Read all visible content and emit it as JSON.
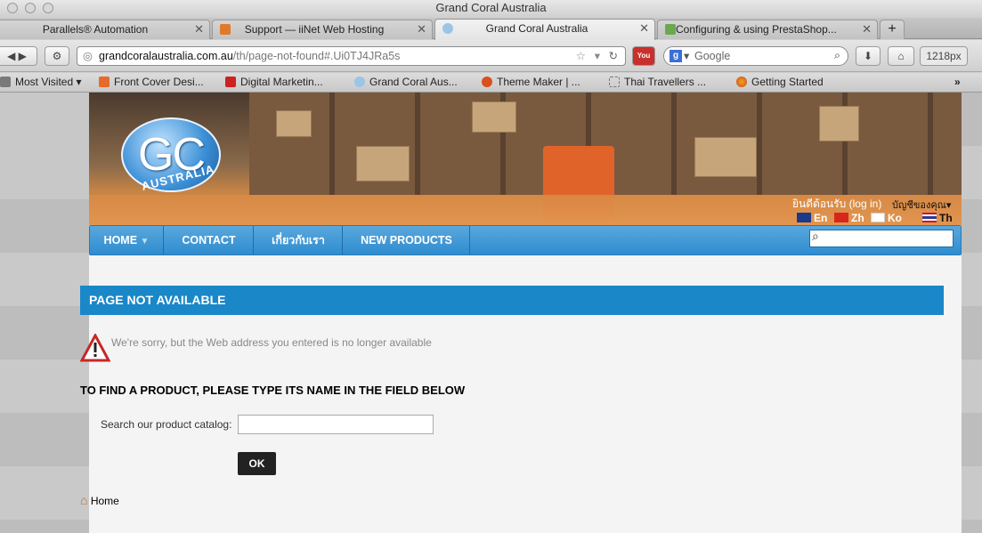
{
  "window": {
    "title": "Grand Coral Australia"
  },
  "tabs": [
    {
      "label": "Parallels® Automation",
      "active": false
    },
    {
      "label": "Support — iiNet Web Hosting",
      "active": false
    },
    {
      "label": "Grand Coral Australia",
      "active": true
    },
    {
      "label": "Configuring & using PrestaShop...",
      "active": false
    }
  ],
  "toolbar": {
    "url_host": "grandcoralaustralia.com.au",
    "url_path": "/th/page-not-found#.Ui0TJ4JRa5s",
    "search_placeholder": "Google",
    "width_label": "1218px",
    "new_tab": "+"
  },
  "bookmarks": [
    {
      "label": "Most Visited",
      "icon": "bookmarks-icon"
    },
    {
      "label": "Front Cover Desi...",
      "icon": "go-icon"
    },
    {
      "label": "Digital Marketin...",
      "icon": "m-icon"
    },
    {
      "label": "Grand Coral Aus...",
      "icon": "globe-icon"
    },
    {
      "label": "Theme Maker | ...",
      "icon": "gear-icon"
    },
    {
      "label": "Thai Travellers ...",
      "icon": "page-icon"
    },
    {
      "label": "Getting Started",
      "icon": "firefox-icon"
    }
  ],
  "site": {
    "logo_text": "GC",
    "logo_sub": "AUSTRALIA",
    "welcome": "ยินดีต้อนรับ",
    "login": "(log in)",
    "account": "บัญชีของคุณ",
    "languages": [
      {
        "code": "En",
        "color": "#1b3a8c"
      },
      {
        "code": "Zh",
        "color": "#d8261c"
      },
      {
        "code": "Ko",
        "color": "#ffffff"
      },
      {
        "code": "Th",
        "color": "#2b3a8f"
      }
    ],
    "menu": [
      {
        "label": "HOME"
      },
      {
        "label": "CONTACT"
      },
      {
        "label": "เกี่ยวกับเรา"
      },
      {
        "label": "NEW PRODUCTS"
      }
    ],
    "page_title": "PAGE NOT AVAILABLE",
    "sorry": "We're sorry, but the Web address you entered is no longer available",
    "find_heading": "TO FIND A PRODUCT, PLEASE TYPE ITS NAME IN THE FIELD BELOW",
    "catalog_label": "Search our product catalog:",
    "ok_label": "OK",
    "home_link": "Home"
  },
  "colors": {
    "menu_blue": "#2e8ccf",
    "title_blue": "#1a87c8",
    "banner_orange": "#d98a44"
  }
}
